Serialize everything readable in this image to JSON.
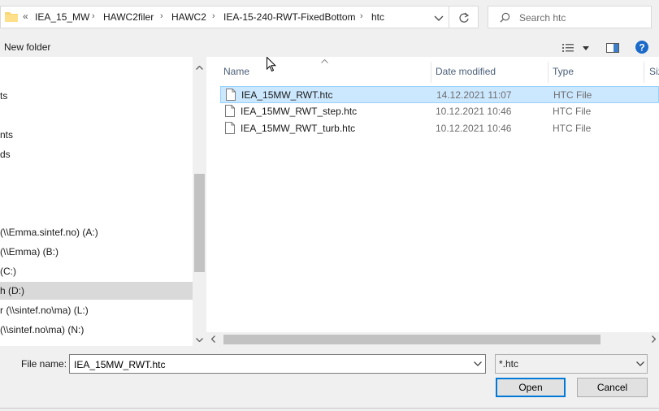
{
  "address": {
    "overflow": "«",
    "crumbs": [
      "IEA_15_MW",
      "HAWC2filer",
      "HAWC2",
      "IEA-15-240-RWT-FixedBottom",
      "htc"
    ]
  },
  "search": {
    "placeholder": "Search htc"
  },
  "toolbar": {
    "new_folder": "New folder"
  },
  "nav": {
    "items": [
      {
        "label": "ts"
      },
      {
        "label": "nts"
      },
      {
        "label": "ds"
      },
      {
        "label": "(\\\\Emma.sintef.no) (A:)"
      },
      {
        "label": "(\\\\Emma) (B:)"
      },
      {
        "label": "(C:)"
      },
      {
        "label": "h (D:)",
        "selected": true
      },
      {
        "label": "r (\\\\sintef.no\\ma) (L:)"
      },
      {
        "label": "(\\\\sintef.no\\ma) (N:)"
      }
    ]
  },
  "columns": {
    "name": "Name",
    "date": "Date modified",
    "type": "Type",
    "size": "Siz"
  },
  "files": [
    {
      "name": "IEA_15MW_RWT.htc",
      "date": "14.12.2021 11:07",
      "type": "HTC File",
      "selected": true
    },
    {
      "name": "IEA_15MW_RWT_step.htc",
      "date": "10.12.2021 10:46",
      "type": "HTC File"
    },
    {
      "name": "IEA_15MW_RWT_turb.htc",
      "date": "10.12.2021 10:46",
      "type": "HTC File"
    }
  ],
  "bottom": {
    "file_name_label": "File name:",
    "file_name_value": "IEA_15MW_RWT.htc",
    "filter": "*.htc",
    "open": "Open",
    "cancel": "Cancel"
  },
  "colors": {
    "accent": "#0078d7",
    "selection": "#cce8ff",
    "selection_border": "#99d1ff"
  }
}
